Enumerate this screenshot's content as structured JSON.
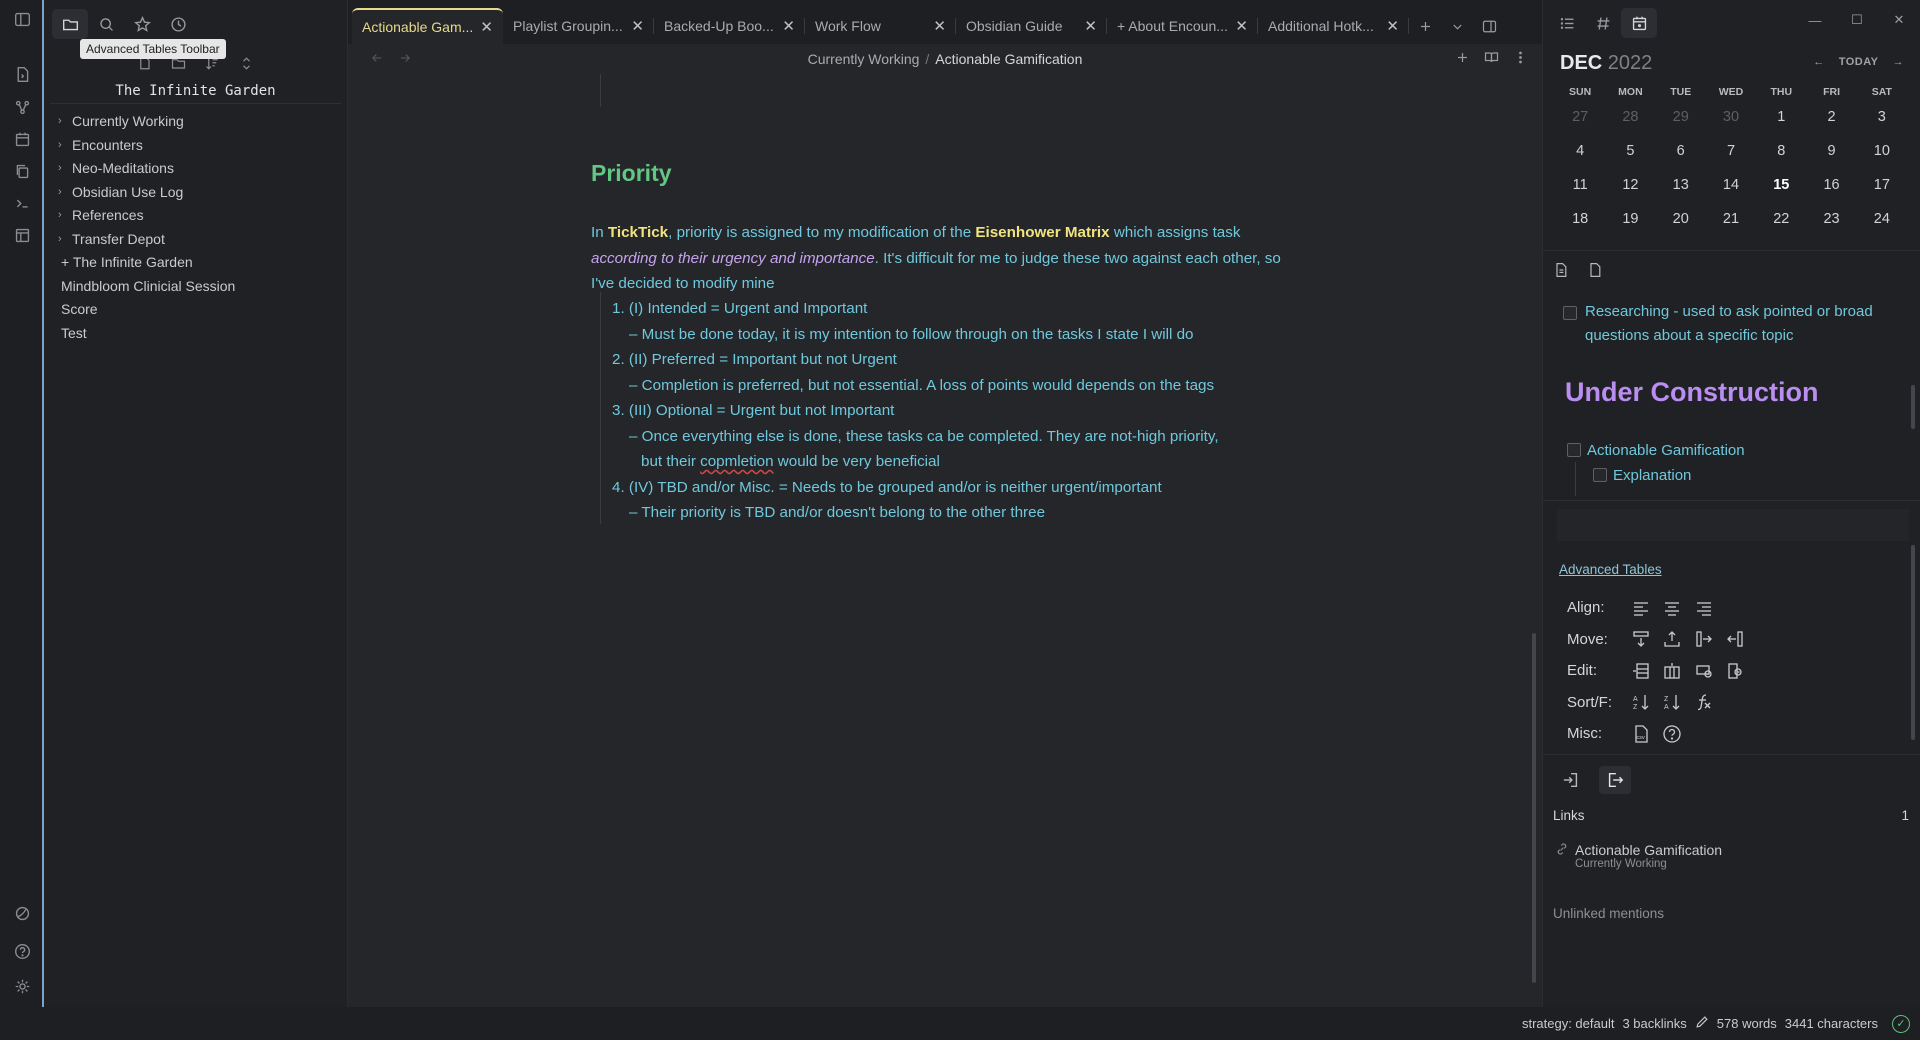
{
  "ribbon": {
    "tooltip": "Advanced Tables Toolbar"
  },
  "explorer": {
    "vault_name": "The Infinite Garden",
    "items": [
      {
        "label": "Currently Working",
        "type": "folder"
      },
      {
        "label": "Encounters",
        "type": "folder"
      },
      {
        "label": "Neo-Meditations",
        "type": "folder"
      },
      {
        "label": "Obsidian Use Log",
        "type": "folder"
      },
      {
        "label": "References",
        "type": "folder"
      },
      {
        "label": "Transfer Depot",
        "type": "folder"
      },
      {
        "label": "+ The Infinite Garden",
        "type": "file"
      },
      {
        "label": "Mindbloom Clinicial Session",
        "type": "file"
      },
      {
        "label": "Score",
        "type": "file"
      },
      {
        "label": "Test",
        "type": "file"
      }
    ]
  },
  "tabs": [
    {
      "label": "Actionable Gam...",
      "active": true
    },
    {
      "label": "Playlist Groupin...",
      "active": false
    },
    {
      "label": "Backed-Up Boo...",
      "active": false
    },
    {
      "label": "Work Flow",
      "active": false
    },
    {
      "label": "Obsidian Guide",
      "active": false
    },
    {
      "label": "+ About Encoun...",
      "active": false
    },
    {
      "label": "Additional Hotk...",
      "active": false
    }
  ],
  "breadcrumb": {
    "parent": "Currently Working",
    "separator": "/",
    "current": "Actionable Gamification"
  },
  "note": {
    "heading": "Priority",
    "para": {
      "t1": "In ",
      "b1": "TickTick",
      "t2": ", priority is assigned to my modification of the ",
      "b2": "Eisenhower Matrix",
      "t3": " which assigns task ",
      "i1": "according to their urgency and importance",
      "t4": ". It's difficult for me to judge these two against each other, so I've decided to modify mine"
    },
    "list": {
      "l1": "1. (I) Intended = Urgent and Important",
      "l1s": "– Must be done today, it is my intention to follow through on the tasks I state I will do",
      "l2": "2. (II) Preferred = Important but not Urgent",
      "l2s": "–  Completion is preferred, but not essential. A loss of points would depends on the tags",
      "l3": "3. (III) Optional = Urgent but not Important",
      "l3s": "– Once everything else is done, these tasks ca be completed. They are not-high priority,",
      "l3s2a": "but their ",
      "l3s2b": "copmletion",
      "l3s2c": " would be very beneficial",
      "l4": "4. (IV) TBD and/or Misc. = Needs to be grouped and/or is neither urgent/important",
      "l4s": "–  Their priority is TBD and/or doesn't belong to the other three"
    }
  },
  "calendar": {
    "month": "DEC",
    "year": "2022",
    "today_label": "TODAY",
    "dow": [
      "SUN",
      "MON",
      "TUE",
      "WED",
      "THU",
      "FRI",
      "SAT"
    ],
    "weeks": [
      [
        "27",
        "28",
        "29",
        "30",
        "1",
        "2",
        "3"
      ],
      [
        "4",
        "5",
        "6",
        "7",
        "8",
        "9",
        "10"
      ],
      [
        "11",
        "12",
        "13",
        "14",
        "15",
        "16",
        "17"
      ],
      [
        "18",
        "19",
        "20",
        "21",
        "22",
        "23",
        "24"
      ]
    ]
  },
  "preview": {
    "task1": "Researching - used to ask pointed or broad questions about a specific topic",
    "heading": "Under Construction",
    "task2": "Actionable Gamification",
    "task3": "Explanation"
  },
  "advanced_tables": {
    "title": "Advanced Tables",
    "rows": [
      "Align:",
      "Move:",
      "Edit:",
      "Sort/F:",
      "Misc:"
    ]
  },
  "links": {
    "header": "Links",
    "count": "1",
    "item_title": "Actionable Gamification",
    "item_path": "Currently Working",
    "unlinked": "Unlinked mentions"
  },
  "status": {
    "strategy": "strategy: default",
    "backlinks": "3 backlinks",
    "words": "578 words",
    "characters": "3441 characters"
  },
  "colors": {
    "accent_tab": "#e7d98a",
    "heading_green": "#63c784",
    "body_cyan": "#6fc8dc",
    "bold_yellow": "#f1e47f",
    "italic_purple": "#c7a3ef",
    "heading_purple": "#b98ef0"
  }
}
